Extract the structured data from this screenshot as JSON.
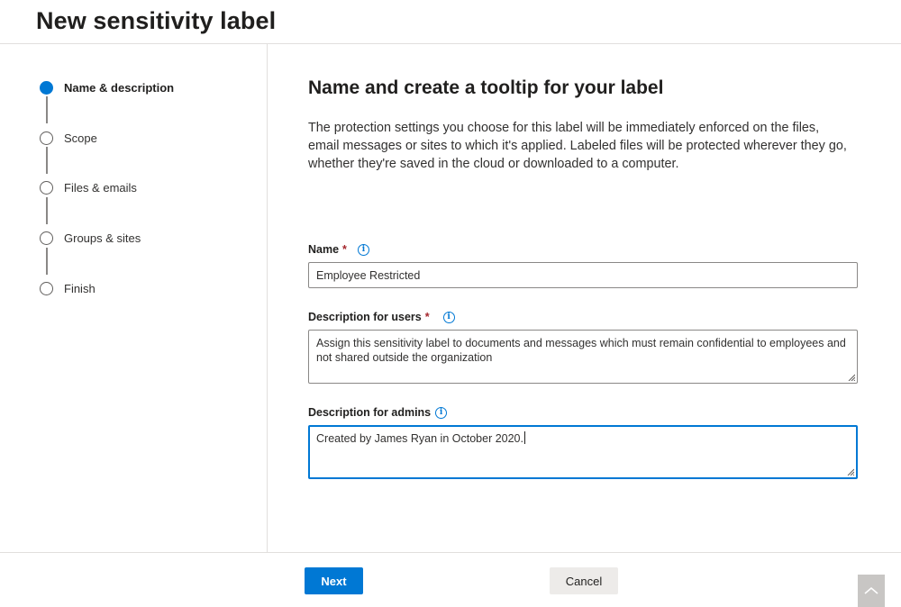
{
  "header": {
    "title": "New sensitivity label"
  },
  "steps": [
    {
      "label": "Name & description",
      "active": true
    },
    {
      "label": "Scope",
      "active": false
    },
    {
      "label": "Files & emails",
      "active": false
    },
    {
      "label": "Groups & sites",
      "active": false
    },
    {
      "label": "Finish",
      "active": false
    }
  ],
  "main": {
    "heading": "Name and create a tooltip for your label",
    "intro": "The protection settings you choose for this label will be immediately enforced on the files, email messages or sites to which it's applied. Labeled files will be protected wherever they go, whether they're saved in the cloud or downloaded to a computer.",
    "fields": {
      "name": {
        "label": "Name",
        "required": "*",
        "value": "Employee Restricted"
      },
      "user_desc": {
        "label": "Description for users",
        "required": "*",
        "value": "Assign this sensitivity label to documents and messages which must remain confidential to employees and not shared outside the organization"
      },
      "admin_desc": {
        "label": "Description for admins",
        "value": "Created by James Ryan in October 2020."
      }
    },
    "info_glyph": "i"
  },
  "footer": {
    "next_label": "Next",
    "cancel_label": "Cancel"
  },
  "icons": {
    "info": "info-icon",
    "scroll_top": "chevron-up-icon"
  },
  "colors": {
    "accent": "#0078d4",
    "required": "#a4262c"
  }
}
